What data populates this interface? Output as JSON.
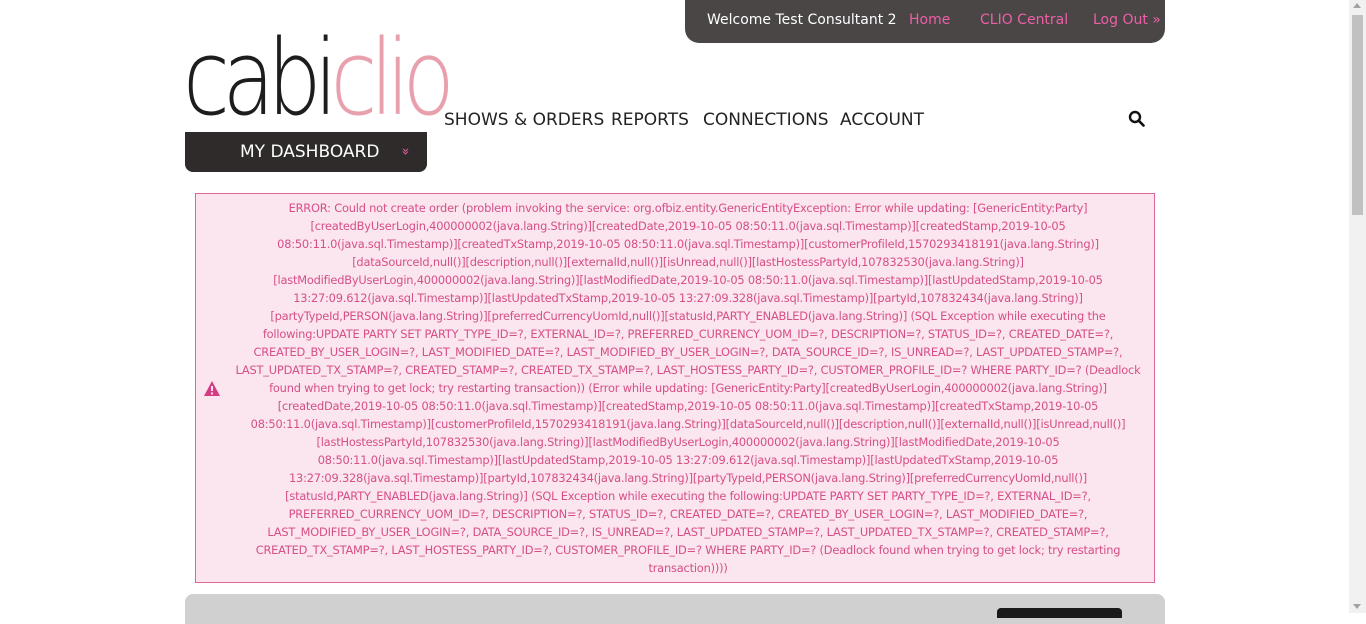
{
  "header": {
    "welcome": "Welcome Test Consultant 2",
    "home": "Home",
    "clio_central": "CLIO Central",
    "logout": "Log Out »"
  },
  "logo": {
    "part1": "cabi",
    "part2": "clio"
  },
  "dashboard": {
    "label": "MY DASHBOARD",
    "chevron": "»"
  },
  "nav": {
    "shows_orders": "SHOWS & ORDERS",
    "reports": "REPORTS",
    "connections": "CONNECTIONS",
    "account": "ACCOUNT"
  },
  "icons": {
    "search": "search-icon",
    "warning": "warning-icon"
  },
  "colors": {
    "accent": "#ee5fa7",
    "error_text": "#d64f86",
    "error_bg": "#fbe5ef",
    "topbar": "#4a4646"
  },
  "error": {
    "message": "ERROR: Could not create order (problem invoking the service: org.ofbiz.entity.GenericEntityException: Error while updating: [GenericEntity:Party][createdByUserLogin,400000002(java.lang.String)][createdDate,2019-10-05 08:50:11.0(java.sql.Timestamp)][createdStamp,2019-10-05 08:50:11.0(java.sql.Timestamp)][createdTxStamp,2019-10-05 08:50:11.0(java.sql.Timestamp)][customerProfileId,1570293418191(java.lang.String)][dataSourceId,null()][description,null()][externalId,null()][isUnread,null()][lastHostessPartyId,107832530(java.lang.String)][lastModifiedByUserLogin,400000002(java.lang.String)][lastModifiedDate,2019-10-05 08:50:11.0(java.sql.Timestamp)][lastUpdatedStamp,2019-10-05 13:27:09.612(java.sql.Timestamp)][lastUpdatedTxStamp,2019-10-05 13:27:09.328(java.sql.Timestamp)][partyId,107832434(java.lang.String)][partyTypeId,PERSON(java.lang.String)][preferredCurrencyUomId,null()][statusId,PARTY_ENABLED(java.lang.String)] (SQL Exception while executing the following:UPDATE PARTY SET PARTY_TYPE_ID=?, EXTERNAL_ID=?, PREFERRED_CURRENCY_UOM_ID=?, DESCRIPTION=?, STATUS_ID=?, CREATED_DATE=?, CREATED_BY_USER_LOGIN=?, LAST_MODIFIED_DATE=?, LAST_MODIFIED_BY_USER_LOGIN=?, DATA_SOURCE_ID=?, IS_UNREAD=?, LAST_UPDATED_STAMP=?, LAST_UPDATED_TX_STAMP=?, CREATED_STAMP=?, CREATED_TX_STAMP=?, LAST_HOSTESS_PARTY_ID=?, CUSTOMER_PROFILE_ID=? WHERE PARTY_ID=? (Deadlock found when trying to get lock; try restarting transaction)) (Error while updating: [GenericEntity:Party][createdByUserLogin,400000002(java.lang.String)][createdDate,2019-10-05 08:50:11.0(java.sql.Timestamp)][createdStamp,2019-10-05 08:50:11.0(java.sql.Timestamp)][createdTxStamp,2019-10-05 08:50:11.0(java.sql.Timestamp)][customerProfileId,1570293418191(java.lang.String)][dataSourceId,null()][description,null()][externalId,null()][isUnread,null()][lastHostessPartyId,107832530(java.lang.String)][lastModifiedByUserLogin,400000002(java.lang.String)][lastModifiedDate,2019-10-05 08:50:11.0(java.sql.Timestamp)][lastUpdatedStamp,2019-10-05 13:27:09.612(java.sql.Timestamp)][lastUpdatedTxStamp,2019-10-05 13:27:09.328(java.sql.Timestamp)][partyId,107832434(java.lang.String)][partyTypeId,PERSON(java.lang.String)][preferredCurrencyUomId,null()][statusId,PARTY_ENABLED(java.lang.String)] (SQL Exception while executing the following:UPDATE PARTY SET PARTY_TYPE_ID=?, EXTERNAL_ID=?, PREFERRED_CURRENCY_UOM_ID=?, DESCRIPTION=?, STATUS_ID=?, CREATED_DATE=?, CREATED_BY_USER_LOGIN=?, LAST_MODIFIED_DATE=?, LAST_MODIFIED_BY_USER_LOGIN=?, DATA_SOURCE_ID=?, IS_UNREAD=?, LAST_UPDATED_STAMP=?, LAST_UPDATED_TX_STAMP=?, CREATED_STAMP=?, CREATED_TX_STAMP=?, LAST_HOSTESS_PARTY_ID=?, CUSTOMER_PROFILE_ID=? WHERE PARTY_ID=? (Deadlock found when trying to get lock; try restarting transaction))))"
  }
}
